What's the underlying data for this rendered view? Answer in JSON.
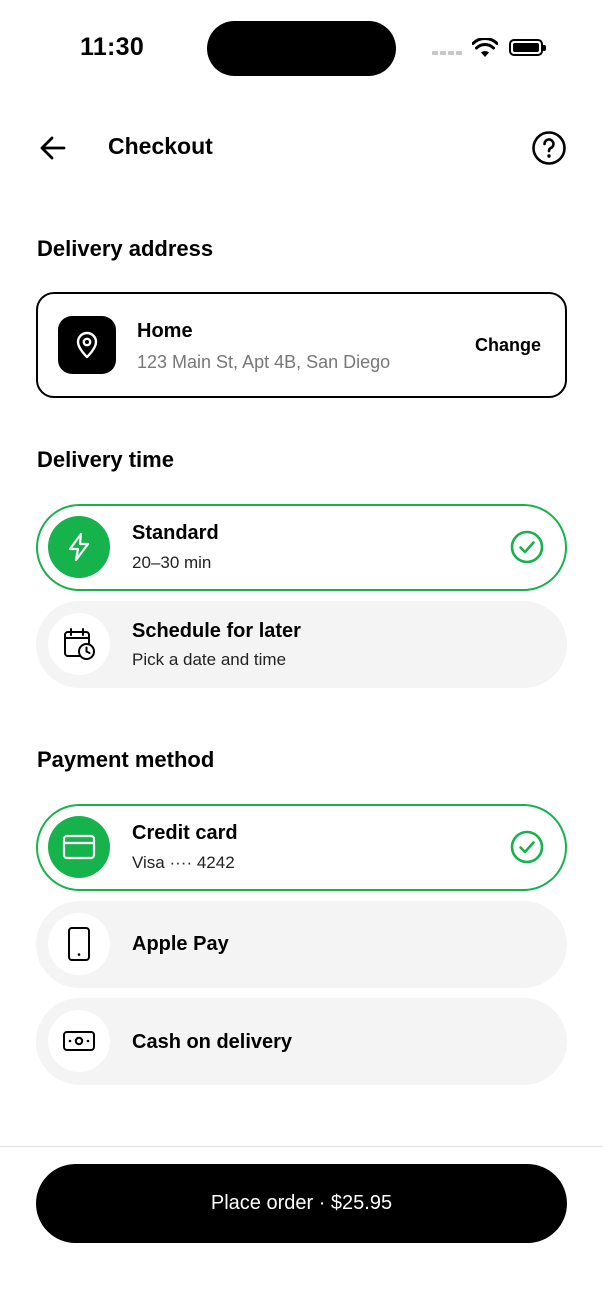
{
  "status_bar": {
    "time": "11:30"
  },
  "header": {
    "title": "Checkout"
  },
  "delivery_address": {
    "section_title": "Delivery address",
    "name": "Home",
    "address": "123 Main St, Apt 4B, San Diego",
    "change_label": "Change",
    "icon": "location-pin-icon"
  },
  "delivery_time": {
    "section_title": "Delivery time",
    "options": [
      {
        "title": "Standard",
        "subtitle": "20–30 min",
        "icon": "lightning-icon",
        "selected": true
      },
      {
        "title": "Schedule for later",
        "subtitle": "Pick a date and time",
        "icon": "calendar-clock-icon",
        "selected": false
      }
    ]
  },
  "payment_method": {
    "section_title": "Payment method",
    "options": [
      {
        "title": "Credit card",
        "subtitle": "Visa ···· 4242",
        "icon": "credit-card-icon",
        "selected": true
      },
      {
        "title": "Apple Pay",
        "icon": "phone-icon",
        "selected": false
      },
      {
        "title": "Cash on delivery",
        "icon": "cash-icon",
        "selected": false
      }
    ]
  },
  "cta": {
    "label": "Place order · $25.95"
  },
  "colors": {
    "accent": "#16b24b",
    "selected_border": "#16b24b",
    "option_bg": "#f4f4f4"
  }
}
